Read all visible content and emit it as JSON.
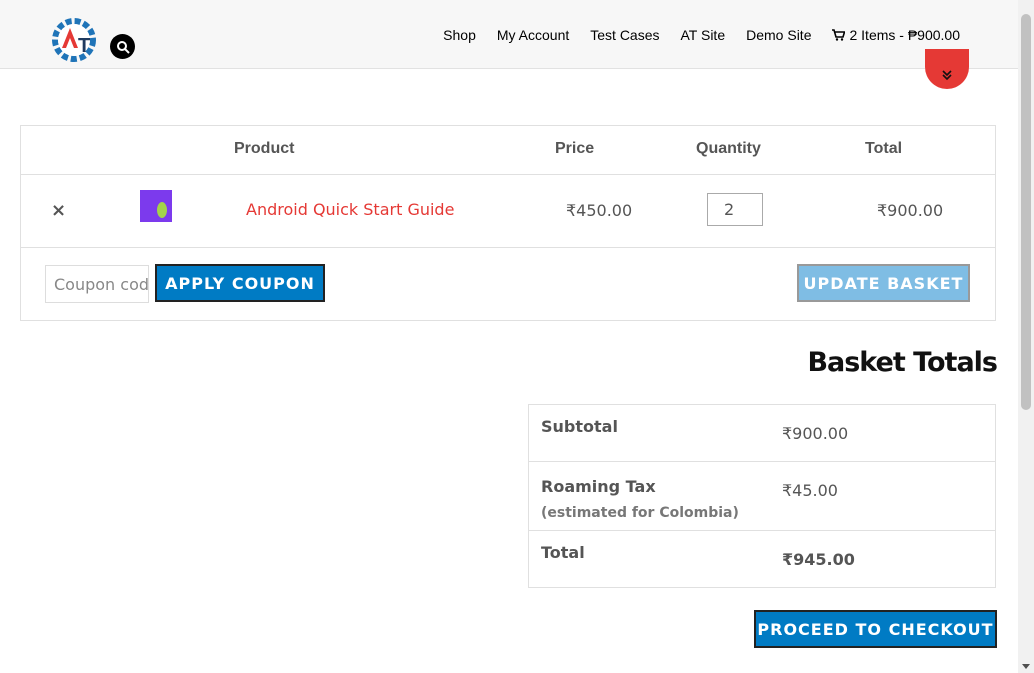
{
  "nav": {
    "shop": "Shop",
    "my_account": "My Account",
    "test_cases": "Test Cases",
    "at_site": "AT Site",
    "demo_site": "Demo Site",
    "cart_summary": "2 Items - ₱900.00"
  },
  "cart": {
    "headers": {
      "product": "Product",
      "price": "Price",
      "quantity": "Quantity",
      "total": "Total"
    },
    "items": [
      {
        "remove": "×",
        "name": "Android Quick Start Guide",
        "price": "₹450.00",
        "quantity": "2",
        "total": "₹900.00"
      }
    ],
    "coupon_placeholder": "Coupon code",
    "apply_label": "APPLY COUPON",
    "update_label": "UPDATE BASKET"
  },
  "totals": {
    "title": "Basket Totals",
    "subtotal_label": "Subtotal",
    "subtotal_value": "₹900.00",
    "tax_label": "Roaming Tax",
    "tax_note": "(estimated for Colombia)",
    "tax_value": "₹45.00",
    "total_label": "Total",
    "total_value": "₹945.00",
    "checkout_label": "PROCEED TO CHECKOUT"
  },
  "colors": {
    "accent": "#007bc4",
    "link": "#e53935",
    "update_disabled": "#7fbde4"
  },
  "icons": {
    "logo": "at-logo",
    "search": "search-icon",
    "cart": "cart-icon",
    "scroll_top": "chevron-up-icon",
    "remove": "close-icon"
  }
}
